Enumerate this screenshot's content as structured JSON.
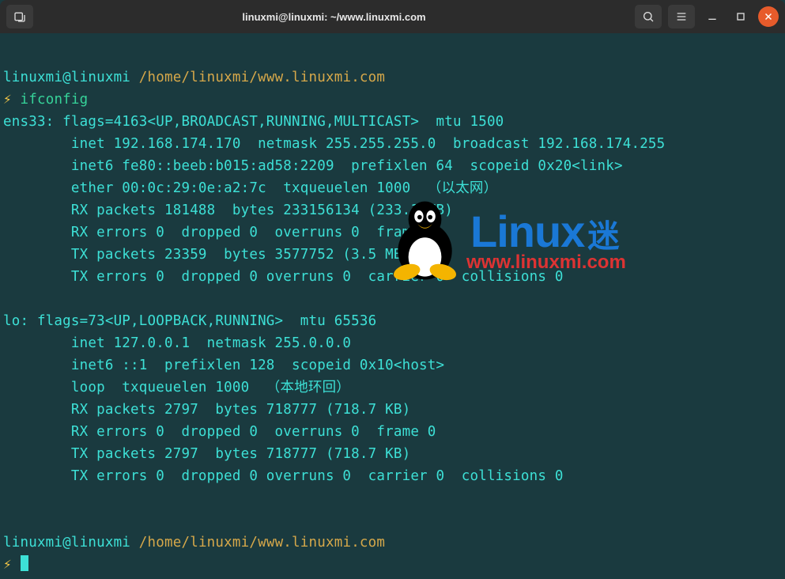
{
  "window": {
    "title": "linuxmi@linuxmi: ~/www.linuxmi.com"
  },
  "prompt1": {
    "user": "linuxmi@linuxmi",
    "path": "/home/linuxmi/www.linuxmi.com",
    "bolt": "⚡",
    "command": "ifconfig"
  },
  "output": {
    "ens33_header": "ens33: flags=4163<UP,BROADCAST,RUNNING,MULTICAST>  mtu 1500",
    "ens33_inet": "        inet 192.168.174.170  netmask 255.255.255.0  broadcast 192.168.174.255",
    "ens33_inet6": "        inet6 fe80::beeb:b015:ad58:2209  prefixlen 64  scopeid 0x20<link>",
    "ens33_ether": "        ether 00:0c:29:0e:a2:7c  txqueuelen 1000  （以太网）",
    "ens33_rxp": "        RX packets 181488  bytes 233156134 (233.1 MB)",
    "ens33_rxe": "        RX errors 0  dropped 0  overruns 0  frame 0",
    "ens33_txp": "        TX packets 23359  bytes 3577752 (3.5 MB)",
    "ens33_txe": "        TX errors 0  dropped 0 overruns 0  carrier 0  collisions 0",
    "blank1": "",
    "lo_header": "lo: flags=73<UP,LOOPBACK,RUNNING>  mtu 65536",
    "lo_inet": "        inet 127.0.0.1  netmask 255.0.0.0",
    "lo_inet6": "        inet6 ::1  prefixlen 128  scopeid 0x10<host>",
    "lo_loop": "        loop  txqueuelen 1000  （本地环回）",
    "lo_rxp": "        RX packets 2797  bytes 718777 (718.7 KB)",
    "lo_rxe": "        RX errors 0  dropped 0  overruns 0  frame 0",
    "lo_txp": "        TX packets 2797  bytes 718777 (718.7 KB)",
    "lo_txe": "        TX errors 0  dropped 0 overruns 0  carrier 0  collisions 0"
  },
  "prompt2": {
    "user": "linuxmi@linuxmi",
    "path": "/home/linuxmi/www.linuxmi.com",
    "bolt": "⚡"
  },
  "watermark": {
    "brand": "Linux",
    "brand_cn": "迷",
    "url": "www.linuxmi.com"
  }
}
